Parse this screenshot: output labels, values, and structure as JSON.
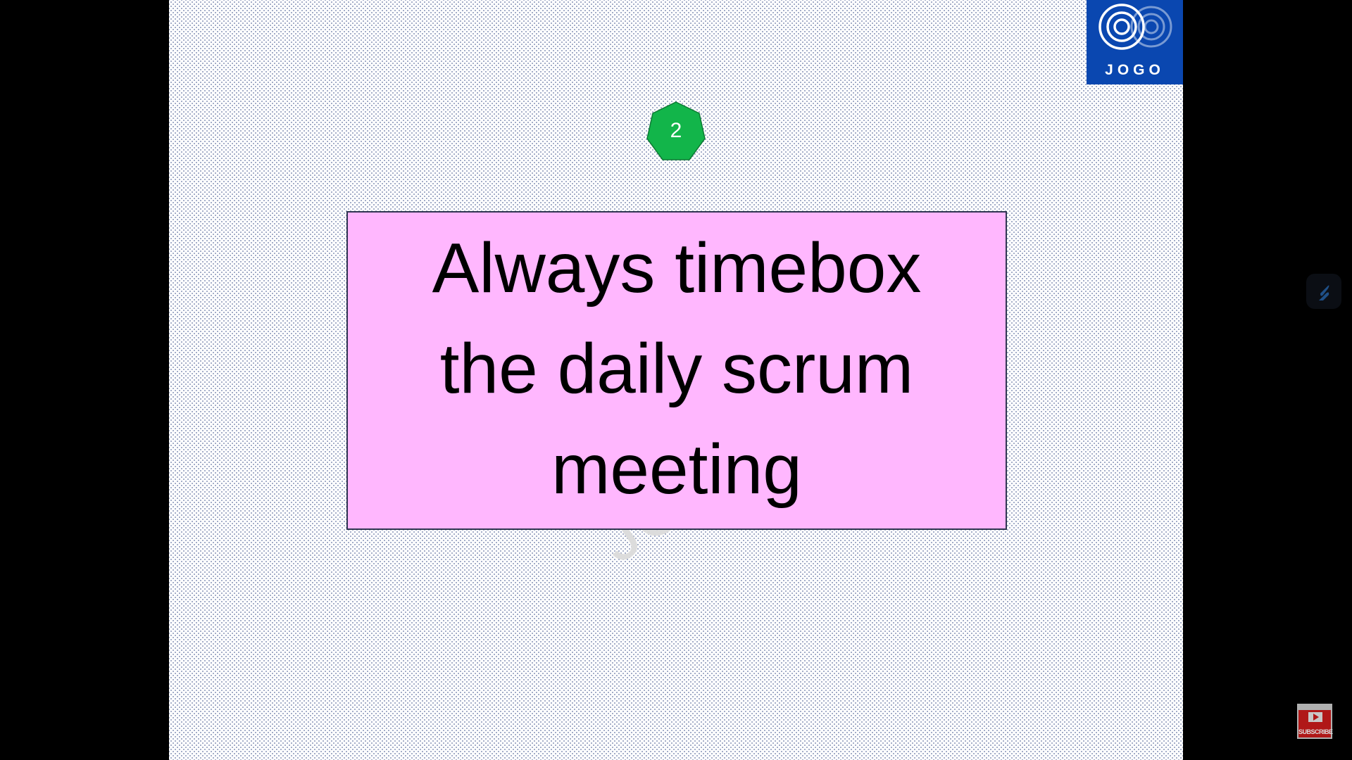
{
  "slide": {
    "watermark": "JOGO Training",
    "logo_text": "JOGO",
    "step_number": "2",
    "step_badge_color": "#12b54a",
    "main_text_lines": [
      "Always timebox",
      "the daily scrum",
      "meeting"
    ],
    "box_color": "#ffb7fe"
  },
  "overlay": {
    "side_app_icon": "s-logo-icon",
    "subscribe_label": "SUBSCRIBE"
  }
}
